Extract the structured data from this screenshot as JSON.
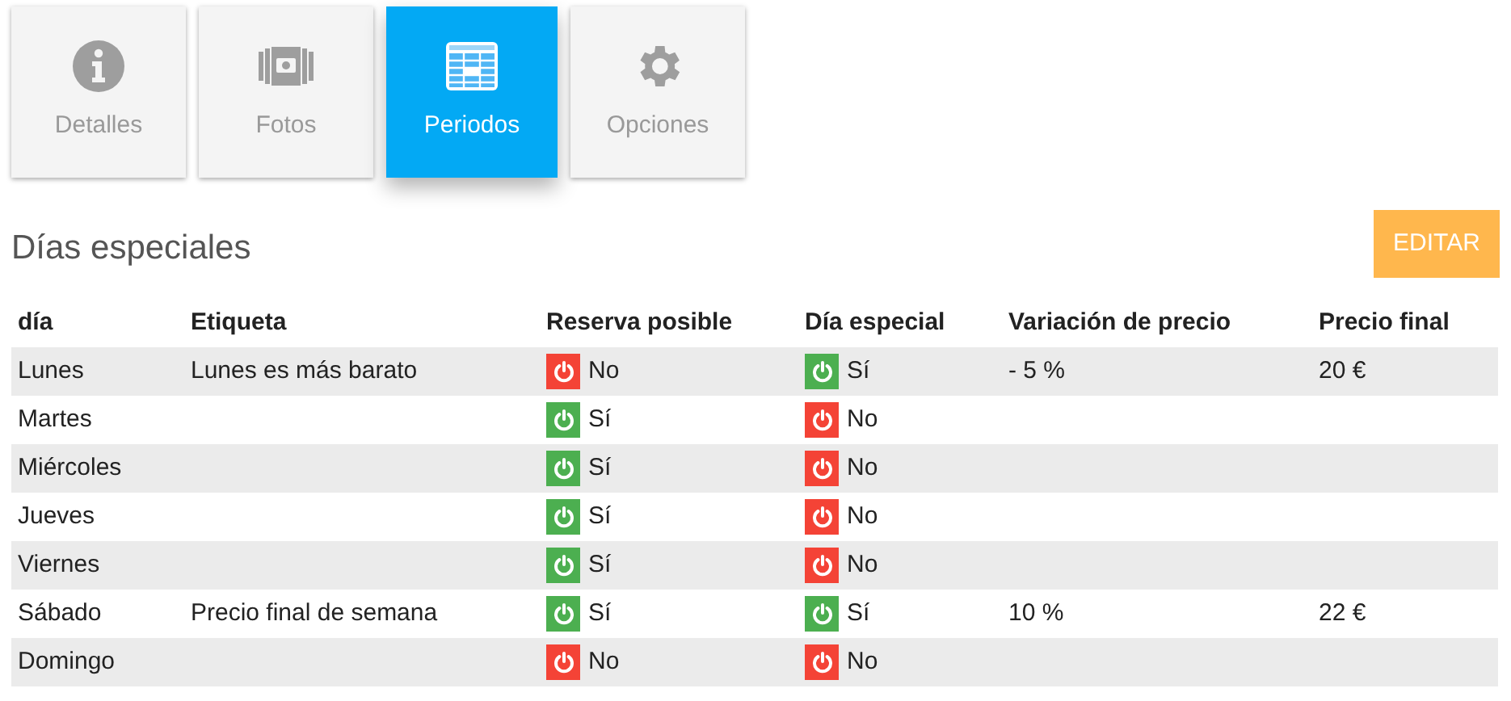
{
  "tabs": [
    {
      "label": "Detalles",
      "kind": "info",
      "selected": false
    },
    {
      "label": "Fotos",
      "kind": "photos",
      "selected": false
    },
    {
      "label": "Periodos",
      "kind": "periods",
      "selected": true
    },
    {
      "label": "Opciones",
      "kind": "options",
      "selected": false
    }
  ],
  "section": {
    "title": "Días especiales",
    "edit_button": "EDITAR"
  },
  "table": {
    "columns": [
      "día",
      "Etiqueta",
      "Reserva posible",
      "Día especial",
      "Variación de precio",
      "Precio final"
    ],
    "rows": [
      {
        "day": "Lunes",
        "label": "Lunes es más barato",
        "booking": {
          "on": false,
          "text": "No"
        },
        "special": {
          "on": true,
          "text": "Sí"
        },
        "variation": "- 5 %",
        "final_price": "20 €"
      },
      {
        "day": "Martes",
        "booking": {
          "on": true,
          "text": "Sí"
        },
        "special": {
          "on": false,
          "text": "No"
        }
      },
      {
        "day": "Miércoles",
        "booking": {
          "on": true,
          "text": "Sí"
        },
        "special": {
          "on": false,
          "text": "No"
        }
      },
      {
        "day": "Jueves",
        "booking": {
          "on": true,
          "text": "Sí"
        },
        "special": {
          "on": false,
          "text": "No"
        }
      },
      {
        "day": "Viernes",
        "booking": {
          "on": true,
          "text": "Sí"
        },
        "special": {
          "on": false,
          "text": "No"
        }
      },
      {
        "day": "Sábado",
        "label": "Precio final de semana",
        "booking": {
          "on": true,
          "text": "Sí"
        },
        "special": {
          "on": true,
          "text": "Sí"
        },
        "variation": "10 %",
        "final_price": "22 €"
      },
      {
        "day": "Domingo",
        "booking": {
          "on": false,
          "text": "No"
        },
        "special": {
          "on": false,
          "text": "No"
        }
      }
    ]
  }
}
